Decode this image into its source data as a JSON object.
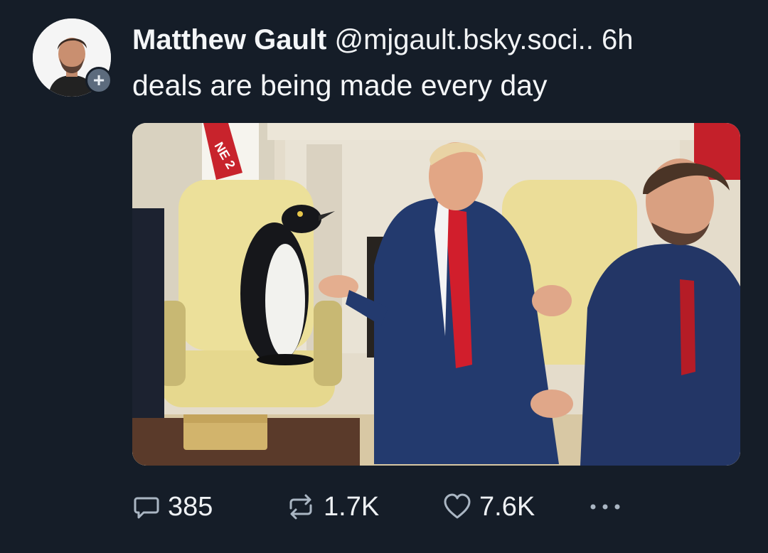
{
  "post": {
    "display_name": "Matthew Gault",
    "handle": "@mjgault.bsky.soci..",
    "timestamp": "6h",
    "text": "deals are being made every day",
    "follow_icon": "plus-icon"
  },
  "image": {
    "banner_text": "NE 2"
  },
  "actions": {
    "reply_count": "385",
    "repost_count": "1.7K",
    "like_count": "7.6K",
    "more_icon": "ellipsis-icon"
  },
  "colors": {
    "background": "#151d28",
    "text": "#f4f6f8",
    "badge": "#5c6b7d"
  }
}
